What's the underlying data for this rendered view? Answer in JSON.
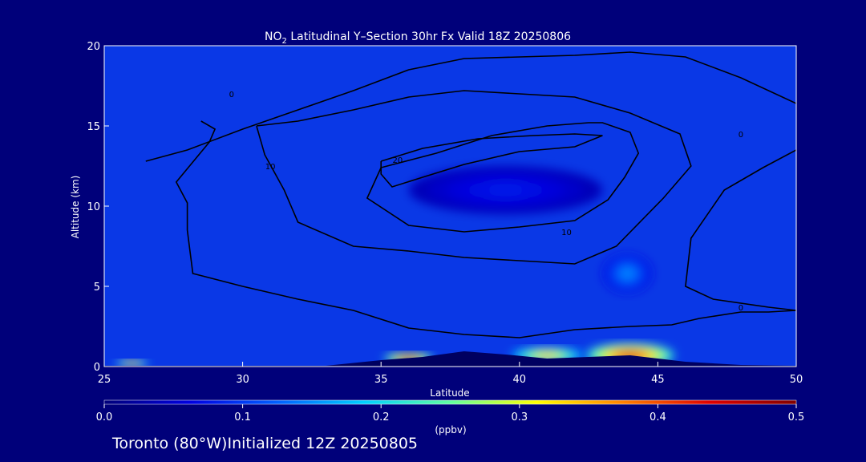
{
  "title_prefix": "NO",
  "title_sub": "2",
  "title_rest": " Latitudinal Y–Section 30hr  Fx Valid 18Z 20250806",
  "footer_text": "Toronto (80°W)Initialized 12Z 20250805",
  "colors": {
    "background": "#00007a",
    "field_base": "#0a38e6",
    "contour": "#000000",
    "text": "#ffffff"
  },
  "chart_data": {
    "type": "heatmap",
    "xlabel": "Latitude",
    "ylabel": "Altitude (km)",
    "xlim": [
      25,
      50
    ],
    "ylim": [
      0,
      20
    ],
    "xticks": [
      25,
      30,
      35,
      40,
      45,
      50
    ],
    "yticks": [
      0,
      5,
      10,
      15,
      20
    ],
    "colorbar": {
      "label": "(ppbv)",
      "min": 0.0,
      "max": 0.5,
      "ticks": [
        "0.0",
        "0.1",
        "0.2",
        "0.3",
        "0.4",
        "0.5"
      ],
      "colormap": [
        "#00007a",
        "#0000e0",
        "#0060ff",
        "#00d0ff",
        "#60ffa0",
        "#ffff00",
        "#ff8000",
        "#e00000",
        "#800000"
      ]
    },
    "field_blobs": [
      {
        "lat": 44.0,
        "alt": 0.7,
        "rlat": 1.6,
        "ralt": 0.75,
        "value": 0.45
      },
      {
        "lat": 41.0,
        "alt": 0.7,
        "rlat": 1.3,
        "ralt": 0.5,
        "value": 0.35
      },
      {
        "lat": 36.0,
        "alt": 0.5,
        "rlat": 0.9,
        "ralt": 0.35,
        "value": 0.45
      },
      {
        "lat": 26.0,
        "alt": 0.2,
        "rlat": 0.6,
        "ralt": 0.2,
        "value": 0.4
      },
      {
        "lat": 43.9,
        "alt": 5.8,
        "rlat": 0.9,
        "ralt": 1.2,
        "value": 0.15
      },
      {
        "lat": 39.5,
        "alt": 11.0,
        "rlat": 3.5,
        "ralt": 1.5,
        "value": 0.08
      }
    ],
    "contours": [
      {
        "level": "0",
        "label_at": [
          29.6,
          16.8
        ],
        "points": [
          [
            28.5,
            15.3
          ],
          [
            29,
            14.8
          ],
          [
            28.8,
            14.0
          ],
          [
            27.6,
            11.5
          ],
          [
            28.0,
            10.2
          ],
          [
            28.0,
            8.5
          ],
          [
            28.2,
            5.8
          ],
          [
            30,
            5.0
          ],
          [
            32,
            4.2
          ],
          [
            34,
            3.5
          ],
          [
            36,
            2.4
          ],
          [
            38,
            2.0
          ],
          [
            40,
            1.8
          ],
          [
            42,
            2.3
          ],
          [
            44,
            2.5
          ],
          [
            45.5,
            2.6
          ],
          [
            46.5,
            3.0
          ],
          [
            48,
            3.4
          ],
          [
            49,
            3.4
          ],
          [
            50,
            3.5
          ]
        ]
      },
      {
        "level": "0",
        "label_at": [
          48.0,
          14.3
        ],
        "points": [
          [
            26.5,
            12.8
          ],
          [
            28,
            13.5
          ],
          [
            30,
            14.8
          ],
          [
            32,
            16.0
          ],
          [
            34,
            17.2
          ],
          [
            36,
            18.5
          ],
          [
            38,
            19.2
          ],
          [
            40,
            19.3
          ],
          [
            42,
            19.4
          ],
          [
            44,
            19.6
          ],
          [
            46,
            19.3
          ],
          [
            48,
            18.0
          ],
          [
            50,
            16.4
          ]
        ]
      },
      {
        "level": "0",
        "label_at": [
          48.0,
          3.5
        ],
        "points": [
          [
            50,
            13.5
          ],
          [
            48.8,
            12.4
          ],
          [
            47.4,
            11.0
          ],
          [
            46.2,
            8.0
          ],
          [
            46.0,
            5.0
          ],
          [
            47,
            4.2
          ],
          [
            49,
            3.7
          ],
          [
            50,
            3.5
          ]
        ]
      },
      {
        "level": "10",
        "label_at": [
          31.0,
          12.3
        ],
        "points": [
          [
            30.5,
            15.0
          ],
          [
            30.8,
            13.2
          ],
          [
            31.5,
            11.0
          ],
          [
            32,
            9.0
          ],
          [
            34,
            7.5
          ],
          [
            36,
            7.2
          ],
          [
            38,
            6.8
          ],
          [
            40,
            6.6
          ],
          [
            42,
            6.4
          ],
          [
            43.5,
            7.5
          ],
          [
            45.2,
            10.5
          ],
          [
            46.2,
            12.5
          ],
          [
            45.8,
            14.5
          ],
          [
            44,
            15.8
          ],
          [
            42,
            16.8
          ],
          [
            40,
            17.0
          ],
          [
            38,
            17.2
          ],
          [
            36,
            16.8
          ],
          [
            34,
            16.0
          ],
          [
            32,
            15.3
          ],
          [
            30.5,
            15.0
          ]
        ]
      },
      {
        "level": "10",
        "label_at": [
          41.7,
          8.2
        ],
        "points": [
          [
            35.0,
            12.4
          ],
          [
            37,
            13.3
          ],
          [
            39,
            14.4
          ],
          [
            41,
            15.0
          ],
          [
            42.5,
            15.2
          ],
          [
            43.0,
            15.2
          ],
          [
            44.0,
            14.6
          ],
          [
            44.3,
            13.3
          ],
          [
            43.8,
            11.8
          ],
          [
            43.2,
            10.4
          ],
          [
            42.0,
            9.1
          ],
          [
            40,
            8.7
          ],
          [
            38,
            8.4
          ],
          [
            36,
            8.8
          ],
          [
            34.5,
            10.5
          ],
          [
            35.0,
            12.4
          ]
        ]
      },
      {
        "level": "20",
        "label_at": [
          35.6,
          12.7
        ],
        "points": [
          [
            35.0,
            12.8
          ],
          [
            36.5,
            13.6
          ],
          [
            38.5,
            14.2
          ],
          [
            40.5,
            14.4
          ],
          [
            42.0,
            14.5
          ],
          [
            43.0,
            14.4
          ],
          [
            42.0,
            13.7
          ],
          [
            40.0,
            13.4
          ],
          [
            38.0,
            12.6
          ],
          [
            36.5,
            11.8
          ],
          [
            35.4,
            11.2
          ],
          [
            35.0,
            12.0
          ],
          [
            35.0,
            12.8
          ]
        ]
      }
    ],
    "terrain": [
      [
        25,
        0.05
      ],
      [
        33,
        0.05
      ],
      [
        35,
        0.4
      ],
      [
        36.5,
        0.6
      ],
      [
        38,
        0.95
      ],
      [
        39.5,
        0.75
      ],
      [
        41,
        0.5
      ],
      [
        42.5,
        0.6
      ],
      [
        44,
        0.7
      ],
      [
        46,
        0.3
      ],
      [
        48,
        0.1
      ],
      [
        50,
        0.05
      ]
    ]
  }
}
